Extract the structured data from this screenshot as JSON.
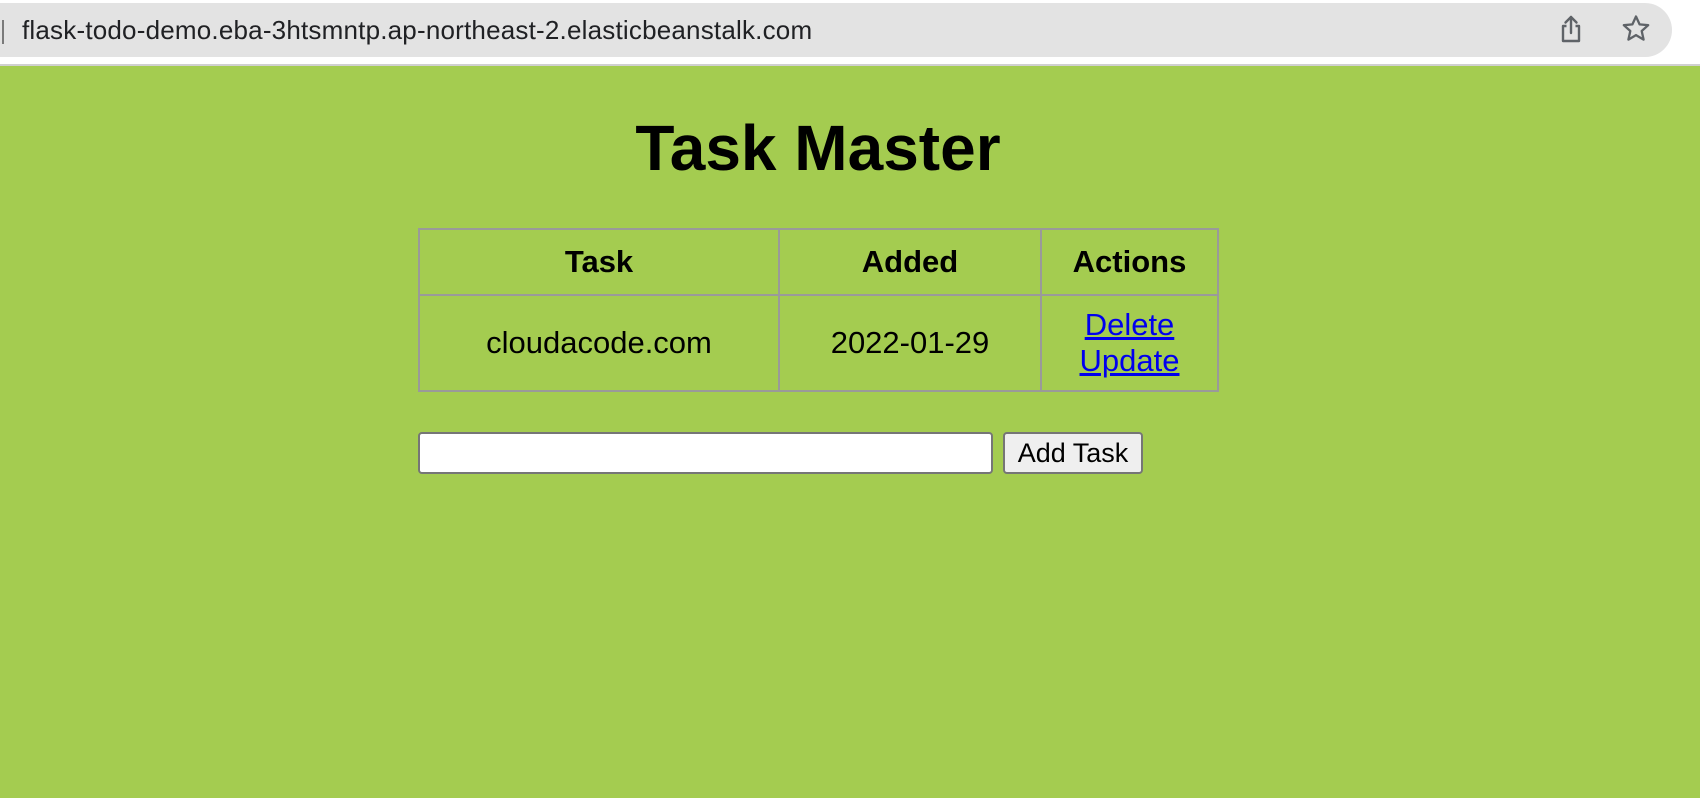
{
  "browser": {
    "url": "flask-todo-demo.eba-3htsmntp.ap-northeast-2.elasticbeanstalk.com",
    "icons": [
      "share-icon",
      "star-icon"
    ]
  },
  "page": {
    "title": "Task Master",
    "background_color": "#a4cc50",
    "link_color": "#0000ee"
  },
  "table": {
    "headers": {
      "task": "Task",
      "added": "Added",
      "actions": "Actions"
    },
    "rows": [
      {
        "task": "cloudacode.com",
        "added": "2022-01-29",
        "delete_label": "Delete",
        "update_label": "Update"
      }
    ]
  },
  "form": {
    "input_value": "",
    "add_label": "Add Task"
  }
}
